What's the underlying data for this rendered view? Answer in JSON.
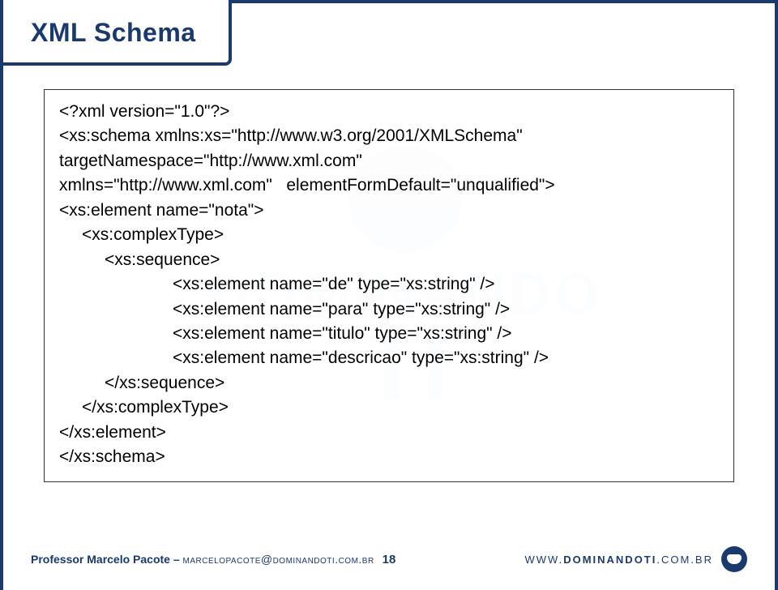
{
  "title": "XML Schema",
  "code": {
    "l1": "<?xml version=\"1.0\"?>",
    "l2": "<xs:schema xmlns:xs=\"http://www.w3.org/2001/XMLSchema\"",
    "l3": "targetNamespace=\"http://www.xml.com\"",
    "l4": "xmlns=\"http://www.xml.com\"   elementFormDefault=\"unqualified\">",
    "l5": "<xs:element name=\"nota\">",
    "l6": "<xs:complexType>",
    "l7": "<xs:sequence>",
    "l8": "<xs:element name=\"de\" type=\"xs:string\" />",
    "l9": "<xs:element name=\"para\" type=\"xs:string\" />",
    "l10": "<xs:element name=\"titulo\" type=\"xs:string\" />",
    "l11": "<xs:element name=\"descricao\" type=\"xs:string\" />",
    "l12": "</xs:sequence>",
    "l13": "</xs:complexType>",
    "l14": "</xs:element>",
    "l15": "</xs:schema>"
  },
  "footer": {
    "author_label": "Professor",
    "author_name": "Marcelo Pacote",
    "separator": " – ",
    "email": "marcelopacote@dominandoti.com.br",
    "page": "18",
    "url_prefix": "WWW.",
    "url_main": "DOMINANDOTI",
    "url_suffix": ".COM.BR"
  },
  "watermark": {
    "line1": "DOMINANDO",
    "line2": "TI"
  }
}
